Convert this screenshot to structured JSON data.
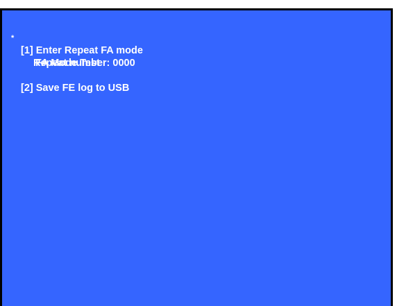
{
  "menu": {
    "marker": "*",
    "title": "FA Mode Test",
    "items": [
      {
        "label": "[1] Enter Repeat FA mode",
        "sub_label": "Repeat number: 0000"
      },
      {
        "label": "[2] Save FE log to USB"
      }
    ]
  },
  "colors": {
    "background": "#3565ff",
    "text": "#ffffff",
    "frame": "#000000"
  }
}
